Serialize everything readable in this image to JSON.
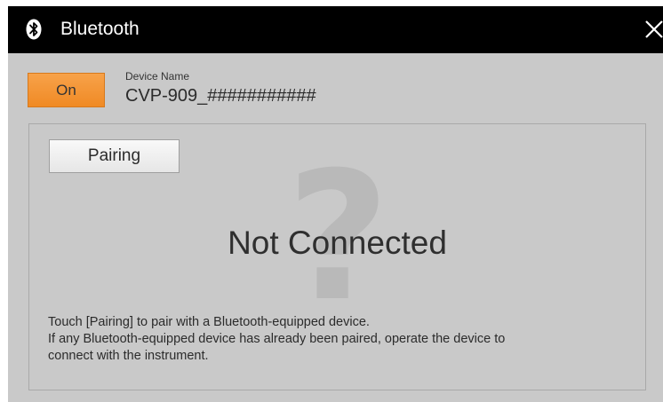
{
  "window": {
    "title": "Bluetooth",
    "icon": "bluetooth-icon",
    "close_icon": "close-icon"
  },
  "bluetooth": {
    "power_label": "On",
    "device_name_label": "Device Name",
    "device_name_value": "CVP-909_###########"
  },
  "pairing": {
    "button_label": "Pairing",
    "status": "Not Connected",
    "help_lines": [
      "Touch [Pairing] to pair with a Bluetooth-equipped device.",
      "If any Bluetooth-equipped device has already been paired, operate the device to",
      "connect with the instrument."
    ]
  },
  "colors": {
    "accent": "#f08a24",
    "background": "#c9c9c9",
    "titlebar": "#000000"
  }
}
